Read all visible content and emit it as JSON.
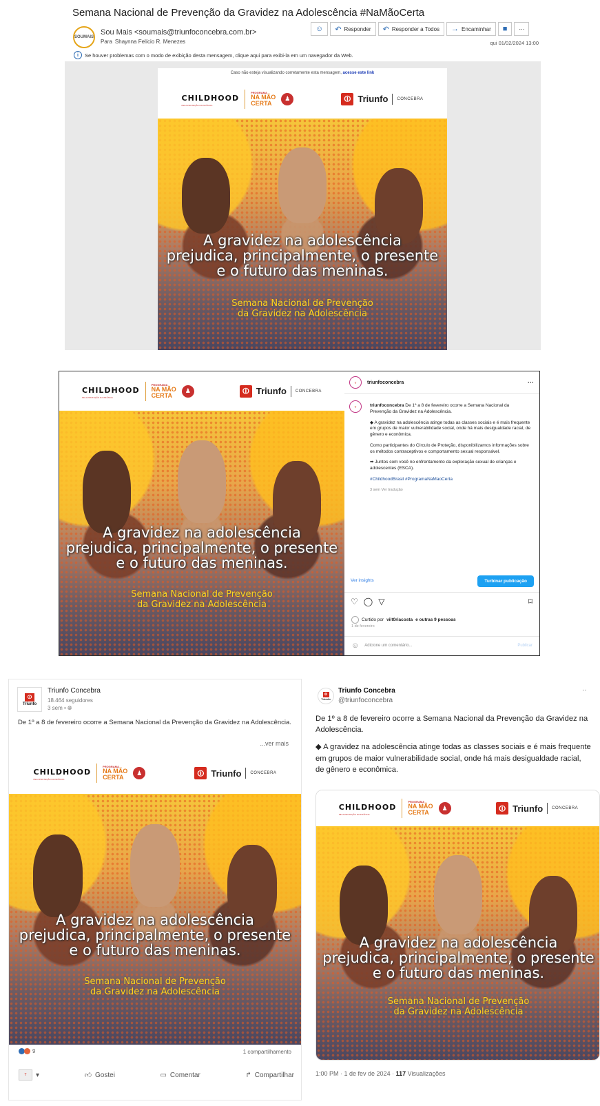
{
  "email": {
    "subject": "Semana Nacional de Prevenção da Gravidez na Adolescência #NaMãoCerta",
    "from": "Sou Mais <soumais@triunfoconcebra.com.br>",
    "to_label": "Para",
    "to": "Shaynna Felício R. Menezes",
    "avatar_text": "SOUMAIS",
    "actions": {
      "emoji_icon": "smiley-icon",
      "reply": "Responder",
      "reply_all": "Responder a Todos",
      "forward": "Encaminhar",
      "teams_icon": "teams-icon",
      "more": "⋯"
    },
    "date": "qui 01/02/2024 13:00",
    "info_bar": "Se houver problemas com o modo de exibição desta mensagem, clique aqui para exibi-la em um navegador da Web.",
    "notice_text": "Caso não esteja visualizando corretamente esta mensagem,",
    "notice_link": "acesse este link"
  },
  "creative": {
    "childhood": "CHILDHOOD",
    "childhood_sub": "PELA PROTEÇÃO DA INFÂNCIA",
    "programa": "PROGRAMA",
    "na_mao": "NA MÃO",
    "certa": "CERTA",
    "triunfo": "Triunfo",
    "concebra": "CONCEBRA",
    "headline_1": "A gravidez na adolescência",
    "headline_2": "prejudica, principalmente, o presente",
    "headline_3": "e o futuro das meninas.",
    "sub_1": "Semana Nacional de Prevenção",
    "sub_2": "da Gravidez na Adolescência"
  },
  "instagram": {
    "username": "triunfoconcebra",
    "more": "···",
    "caption_intro": "De 1º a 8 de fevereiro ocorre a Semana Nacional da Prevenção da Gravidez na Adolescência.",
    "p1": "◆ A gravidez na adolescência atinge todas as classes sociais e é mais frequente em grupos de maior vulnerabilidade social, onde há mais desigualdade racial, de gênero e econômica.",
    "p2": "Como participantes do Círculo de Proteção, disponibilizamos informações sobre os métodos contraceptivos e comportamento sexual responsável.",
    "p3": "➡ Juntos com você no enfrentamento da exploração sexual de crianças e adolescentes (ESCA).",
    "hashtags": "#ChildhoodBrasil #ProgramaNaMaoCerta",
    "meta": "3 sem   Ver tradução",
    "insights": "Ver insights",
    "boost": "Turbinar publicação",
    "liked_prefix": "Curtido por",
    "liked_user": "viit0riacosta",
    "liked_suffix": "e outras 9 pessoas",
    "post_date": "1 de fevereiro",
    "comment_placeholder": "Adicione um comentário...",
    "publish": "Publicar"
  },
  "linkedin": {
    "logo_text": "Triunfo",
    "name": "Triunfo Concebra",
    "followers": "18.464 seguidores",
    "time": "3 sem • ",
    "text": "De 1º a 8 de fevereiro ocorre a Semana Nacional da Prevenção da Gravidez na Adolescência.",
    "see_more": "...ver mais",
    "reactions_count": "9",
    "shares": "1 compartilhamento",
    "like": "Gostei",
    "comment": "Comentar",
    "share": "Compartilhar"
  },
  "twitter": {
    "name": "Triunfo Concebra",
    "handle": "@triunfoconcebra",
    "p1": "De 1º a 8 de fevereiro ocorre a Semana Nacional da Prevenção da Gravidez na Adolescência.",
    "p2": "◆ A gravidez na adolescência atinge todas as classes sociais e é mais frequente em grupos de maior vulnerabilidade social, onde há mais desigualdade racial, de gênero e econômica.",
    "footer_time": "1:00 PM · 1 de fev de 2024 · ",
    "views_count": "117",
    "views_label": "Visualizações"
  },
  "colors": {
    "triunfo_red": "#d52b1e",
    "link_blue": "#2b7be4",
    "headline_yellow": "#ffd21f"
  }
}
